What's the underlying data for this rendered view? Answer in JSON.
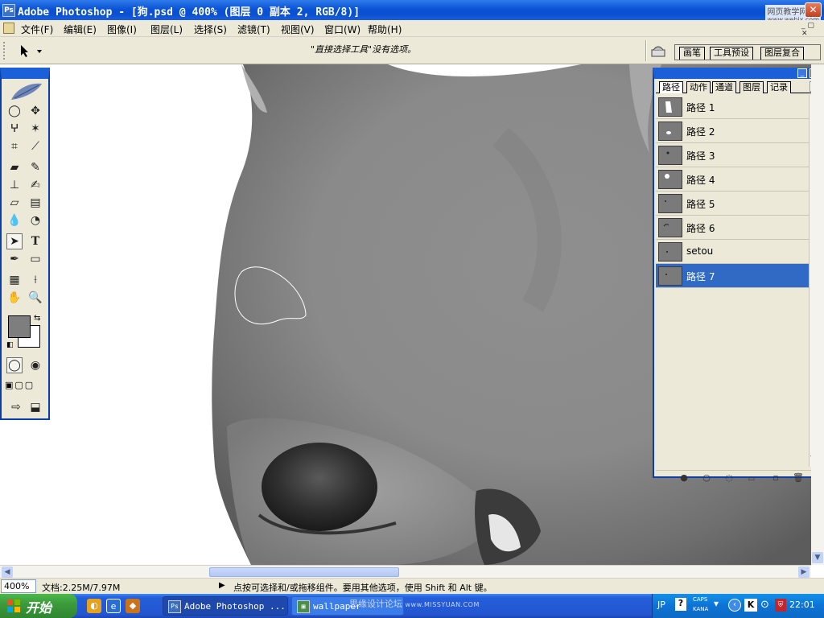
{
  "window": {
    "title": "Adobe Photoshop - [狗.psd @ 400% (图层 0 副本 2, RGB/8)]",
    "watermark_text": "网页教学网",
    "watermark_url": "www.webjx.com"
  },
  "menubar": {
    "items": [
      "文件(F)",
      "编辑(E)",
      "图像(I)",
      "图层(L)",
      "选择(S)",
      "滤镜(T)",
      "视图(V)",
      "窗口(W)",
      "帮助(H)"
    ]
  },
  "options": {
    "hint": "\"直接选择工具\"没有选项。",
    "wells": [
      "画笔",
      "工具预设",
      "图层复合"
    ]
  },
  "paths_palette": {
    "tabs": [
      "路径",
      "动作",
      "通道",
      "图层",
      "记录"
    ],
    "active_tab": "路径",
    "paths": [
      {
        "label": "路径 1"
      },
      {
        "label": "路径 2"
      },
      {
        "label": "路径 3"
      },
      {
        "label": "路径 4"
      },
      {
        "label": "路径 5"
      },
      {
        "label": "路径 6"
      },
      {
        "label": "setou"
      },
      {
        "label": "路径 7",
        "selected": true
      }
    ],
    "bottom_icons": [
      "fill-path-icon",
      "stroke-path-icon",
      "load-selection-icon",
      "make-work-path-icon",
      "new-path-icon",
      "delete-path-icon"
    ]
  },
  "status": {
    "zoom": "400%",
    "doc": "文档:2.25M/7.97M",
    "hint": "点按可选择和/或拖移组件。要用其他选项，使用 Shift 和 Alt 键。"
  },
  "taskbar": {
    "start_label": "开始",
    "tasks": [
      {
        "label": "Adobe Photoshop ...",
        "active": true
      },
      {
        "label": "wallpaper",
        "active": false
      }
    ],
    "watermark": "思缘设计论坛",
    "watermark_url": "www.MISSYUAN.COM",
    "lang": "JP",
    "caps": "CAPS",
    "kana": "KANA",
    "clock": "22:01"
  },
  "colors": {
    "title_blue": "#0a53d6",
    "selection_blue": "#316ac5",
    "chrome": "#ece9d8",
    "start_green": "#3c9b3c"
  }
}
